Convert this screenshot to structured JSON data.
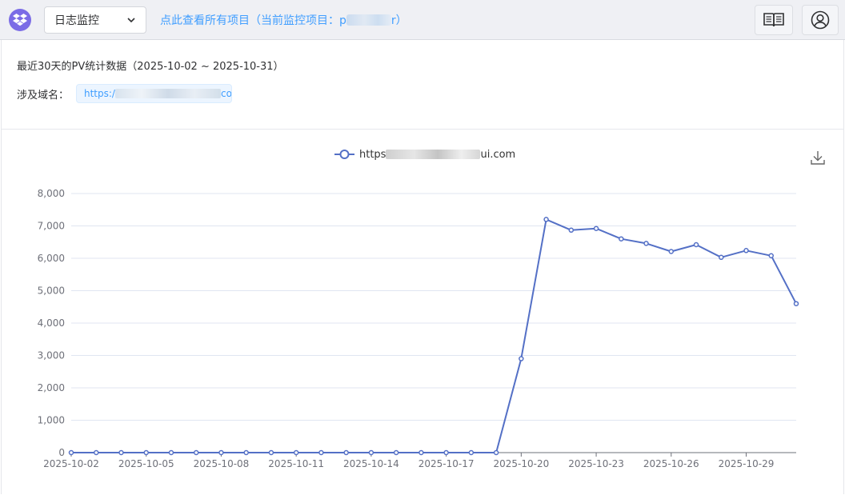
{
  "header": {
    "logo_icon": "dropbox-style-logo-icon",
    "select_value": "日志监控",
    "link_prefix": "点此查看所有项目（当前监控项目：p",
    "link_suffix": "r）",
    "help_icon": "book-icon",
    "user_icon": "user-circle-icon"
  },
  "summary": {
    "title": "最近30天的PV统计数据（2025-10-02 ~ 2025-10-31）",
    "domain_label": "涉及域名：",
    "domain_prefix": "https:/",
    "domain_suffix": "com"
  },
  "chart_controls": {
    "download_icon": "download-icon"
  },
  "chart_data": {
    "type": "line",
    "title": "",
    "xlabel": "",
    "ylabel": "",
    "ylim": [
      0,
      8000
    ],
    "yticks": [
      0,
      1000,
      2000,
      3000,
      4000,
      5000,
      6000,
      7000,
      8000
    ],
    "ytick_labels": [
      "0",
      "1,000",
      "2,000",
      "3,000",
      "4,000",
      "5,000",
      "6,000",
      "7,000",
      "8,000"
    ],
    "xtick_labels": [
      "2025-10-02",
      "2025-10-05",
      "2025-10-08",
      "2025-10-11",
      "2025-10-14",
      "2025-10-17",
      "2025-10-20",
      "2025-10-23",
      "2025-10-26",
      "2025-10-29"
    ],
    "grid": true,
    "legend_position": "top-center",
    "series_color": "#5470c6",
    "x": [
      "2025-10-02",
      "2025-10-03",
      "2025-10-04",
      "2025-10-05",
      "2025-10-06",
      "2025-10-07",
      "2025-10-08",
      "2025-10-09",
      "2025-10-10",
      "2025-10-11",
      "2025-10-12",
      "2025-10-13",
      "2025-10-14",
      "2025-10-15",
      "2025-10-16",
      "2025-10-17",
      "2025-10-18",
      "2025-10-19",
      "2025-10-20",
      "2025-10-21",
      "2025-10-22",
      "2025-10-23",
      "2025-10-24",
      "2025-10-25",
      "2025-10-26",
      "2025-10-27",
      "2025-10-28",
      "2025-10-29",
      "2025-10-30",
      "2025-10-31"
    ],
    "series": [
      {
        "name_prefix": "https",
        "name_suffix": "ui.com",
        "values": [
          0,
          0,
          0,
          0,
          0,
          0,
          0,
          0,
          0,
          0,
          0,
          0,
          0,
          0,
          0,
          0,
          0,
          0,
          2900,
          7200,
          6870,
          6920,
          6600,
          6460,
          6210,
          6420,
          6030,
          6240,
          6080,
          4600
        ]
      }
    ]
  }
}
